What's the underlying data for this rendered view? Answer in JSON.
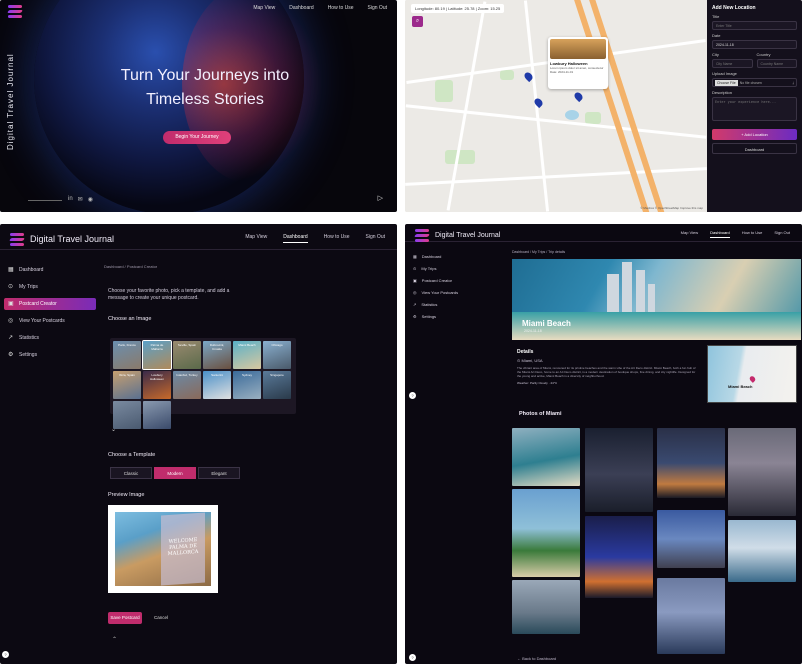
{
  "panel1": {
    "nav": [
      "Map View",
      "Dashboard",
      "How to Use",
      "Sign Out"
    ],
    "vertical_title": "Digital Travel Journal",
    "hero_line1": "Turn Your Journeys into",
    "hero_line2": "Timeless Stories",
    "cta": "Begin Your Journey",
    "social_icons": [
      "linkedin-icon",
      "mail-icon",
      "github-icon"
    ],
    "colors": {
      "accent": "#c02c6c",
      "bg": "#07060c"
    }
  },
  "panel2": {
    "coords": "Longitude: 80.19 | Latitude: 25.78 | Zoom: 15.25",
    "popup_title": "Lowbury Halloween",
    "popup_desc": "Lorem ipsum dolor sit amet, consectetur",
    "popup_meta": "Date: 2024-11-01",
    "map_credit": "© Mapbox © OpenStreetMap Improve this map",
    "form": {
      "heading": "Add New Location",
      "title_label": "Title",
      "title_placeholder": "Enter Title",
      "date_label": "Date",
      "date_value": "2024-11-18",
      "city_label": "City",
      "city_placeholder": "City Name",
      "country_label": "Country",
      "country_placeholder": "Country Name",
      "upload_label": "Upload Image",
      "file_button": "Choose File",
      "file_status": "No file chosen",
      "description_label": "Description",
      "description_placeholder": "Enter your experience here...",
      "add_button": "+ Add Location",
      "dashboard_button": "Dashboard"
    }
  },
  "panel3": {
    "brand": "Digital Travel Journal",
    "nav": [
      "Map View",
      "Dashboard",
      "How to Use",
      "Sign Out"
    ],
    "sidebar": [
      {
        "label": "Dashboard",
        "icon": "grid-icon"
      },
      {
        "label": "My Trips",
        "icon": "pin-icon"
      },
      {
        "label": "Postcard Creator",
        "icon": "image-icon",
        "selected": true
      },
      {
        "label": "View Your Postcards",
        "icon": "eye-icon"
      },
      {
        "label": "Statistics",
        "icon": "chart-icon"
      },
      {
        "label": "Settings",
        "icon": "gear-icon"
      }
    ],
    "breadcrumb": "Dashboard  /  Postcard Creator",
    "intro": "Choose your favorite photo, pick a template, and add a message to create your unique postcard.",
    "choose_image": "Choose an Image",
    "thumbs": [
      "Paris, France",
      "Palma de Mallorca",
      "Seville, Spain",
      "Dubrovnik, Croatia",
      "Miami Beach",
      "Chicago",
      "Ibiza, Spain",
      "Lowbury Halloween",
      "Istanbul, Turkey",
      "Santorini",
      "Sydney",
      "Singapore",
      "",
      ""
    ],
    "choose_template": "Choose a Template",
    "templates": [
      "Classic",
      "Modern",
      "Elegant"
    ],
    "selected_template": "Modern",
    "preview_label": "Preview Image",
    "preview_text": "WELCOME PALMA DE MALLORCA",
    "save": "Save Postcard",
    "cancel": "Cancel"
  },
  "panel4": {
    "brand": "Digital Travel Journal",
    "nav": [
      "Map View",
      "Dashboard",
      "How to Use",
      "Sign Out"
    ],
    "sidebar": [
      "Dashboard",
      "My Trips",
      "Postcard Creator",
      "View Your Postcards",
      "Statistics",
      "Settings"
    ],
    "breadcrumb": "Dashboard  /  My Trips  /  Trip details",
    "banner_title": "Miami Beach",
    "banner_date": "2024-11-18",
    "details_heading": "Details",
    "details_location": "Miami, USA",
    "details_text": "The vibrant area of Miami, renowned for its pristine beaches and the warm vibe of the Art Deco district. Miami Beach, both a fun hub of the Miami Art Deco, home to an Art Deco district, is a modern destination of boutique shops, fine dining, and city nightlife. Designed for the young and active, Miami Beach is a diversity of neighborhood.",
    "details_meta": "Weather:  Partly Cloudy  ·  24°C",
    "map_label": "Miami Beach",
    "photos_heading": "Photos of Miami",
    "back": "←  Back to Dashboard"
  }
}
